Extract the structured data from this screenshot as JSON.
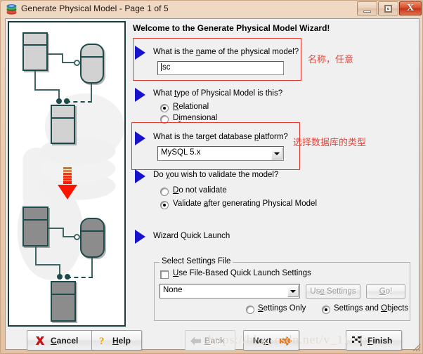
{
  "window": {
    "title": "Generate Physical Model - Page 1 of 5",
    "app_icon": "layered-disc-icon",
    "controls": {
      "minimize": "minimize-icon",
      "maximize": "maximize-icon",
      "close": "X"
    }
  },
  "content": {
    "welcome": "Welcome to the Generate Physical Model Wizard!",
    "q1": {
      "question_pre": "What is the ",
      "question_acc": "n",
      "question_post": "ame of the physical model?",
      "value": "sc"
    },
    "q2": {
      "question_pre": "What ",
      "question_acc": "t",
      "question_post": "ype of Physical Model is this?",
      "options": [
        {
          "acc": "R",
          "pre": "",
          "post": "elational",
          "selected": true
        },
        {
          "acc": "i",
          "pre": "D",
          "post": "mensional",
          "selected": false
        }
      ]
    },
    "q3": {
      "question_pre": "What is the target database ",
      "question_acc": "p",
      "question_post": "latform?",
      "value": "MySQL 5.x"
    },
    "q4": {
      "question_pre": "Do ",
      "question_acc": "y",
      "question_post": "ou wish to validate the model?",
      "options": [
        {
          "acc": "D",
          "pre": "",
          "post": "o not validate",
          "selected": false
        },
        {
          "acc": "a",
          "pre": "Validate ",
          "post": "fter generating Physical Model",
          "selected": true
        }
      ]
    },
    "quick_launch": {
      "heading": "Wizard Quick Launch",
      "group_legend": "Select Settings File",
      "checkbox": {
        "acc": "U",
        "pre": "",
        "post": "se File-Based Quick Launch Settings",
        "checked": false
      },
      "settings_file": "None",
      "use_settings_button": {
        "acc": "e",
        "pre": "Us",
        "post": " Settings",
        "enabled": false
      },
      "go_button": {
        "acc": "G",
        "pre": "",
        "post": "o!",
        "enabled": false
      },
      "radios": [
        {
          "acc": "S",
          "pre": "",
          "post": "ettings Only",
          "selected": false
        },
        {
          "acc": "O",
          "pre": "Settings and ",
          "post": "bjects",
          "selected": true
        }
      ]
    }
  },
  "annotations": {
    "name_note": "名称，任意",
    "platform_note": "选择数据库的类型",
    "accent_color": "#e8453a"
  },
  "buttons": {
    "cancel": {
      "icon": "x-mark-icon",
      "acc": "C",
      "pre": "",
      "post": "ancel",
      "enabled": true
    },
    "help": {
      "icon": "question-mark-icon",
      "acc": "H",
      "pre": "",
      "post": "elp",
      "enabled": true
    },
    "back": {
      "icon": "left-arrow-icon",
      "acc": "B",
      "pre": "",
      "post": "ack",
      "enabled": false
    },
    "next": {
      "icon": "right-arrow-icon",
      "acc": "x",
      "pre": "Ne",
      "post": "t",
      "enabled": true
    },
    "finish": {
      "icon": "checkered-flag-icon",
      "acc": "F",
      "pre": "",
      "post": "inish",
      "enabled": true
    }
  },
  "watermark": "https://blog.csdn.net/v_11nux"
}
